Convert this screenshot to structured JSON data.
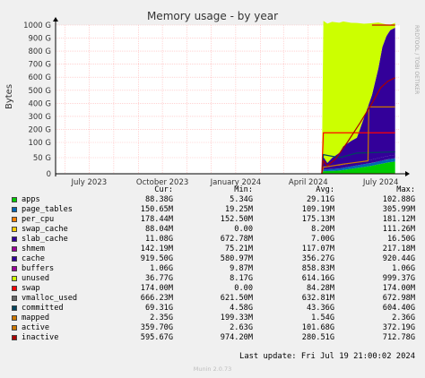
{
  "chart_data": {
    "type": "area",
    "title": "Memory usage - by year",
    "ylabel": "Bytes",
    "side_text": "RRDTOOL / TOBI OETIKER",
    "y_ticks": [
      {
        "value": 0,
        "label": "0"
      },
      {
        "value": 50,
        "label": "50 G"
      },
      {
        "value": 100,
        "label": "100 G"
      },
      {
        "value": 200,
        "label": "200 G"
      },
      {
        "value": 300,
        "label": "300 G"
      },
      {
        "value": 400,
        "label": "400 G"
      },
      {
        "value": 500,
        "label": "500 G"
      },
      {
        "value": 600,
        "label": "600 G"
      },
      {
        "value": 700,
        "label": "700 G"
      },
      {
        "value": 800,
        "label": "800 G"
      },
      {
        "value": 900,
        "label": "900 G"
      },
      {
        "value": 1000,
        "label": "1000 G"
      }
    ],
    "x_ticks": [
      {
        "value": "2023-07",
        "label": "July 2023"
      },
      {
        "value": "2023-10",
        "label": "October 2023"
      },
      {
        "value": "2024-01",
        "label": "January 2024"
      },
      {
        "value": "2024-04",
        "label": "April 2024"
      },
      {
        "value": "2024-07",
        "label": "July 2024"
      }
    ],
    "xlim": [
      "2023-05-20",
      "2024-07-25"
    ],
    "ylim": [
      0,
      1020
    ],
    "y_scale": "segmented linear (0-100 G expanded)",
    "grid": true,
    "stack": [
      {
        "name": "apps",
        "color": "#00cc00",
        "points": [
          [
            "2024-04-18",
            0
          ],
          [
            "2024-04-20",
            8
          ],
          [
            "2024-05-10",
            10
          ],
          [
            "2024-06-01",
            18
          ],
          [
            "2024-06-20",
            25
          ],
          [
            "2024-07-10",
            35
          ],
          [
            "2024-07-19",
            38
          ]
        ]
      },
      {
        "name": "page_tables",
        "color": "#0066b3",
        "points": [
          [
            "2024-04-18",
            0
          ],
          [
            "2024-04-20",
            5
          ],
          [
            "2024-06-01",
            8
          ],
          [
            "2024-07-19",
            10
          ]
        ]
      },
      {
        "name": "swap_cache",
        "color": "#ffcc00",
        "points": [
          [
            "2024-04-18",
            0
          ],
          [
            "2024-07-19",
            0.1
          ]
        ]
      },
      {
        "name": "slab_cache",
        "color": "#330099",
        "points": [
          [
            "2024-04-18",
            0
          ],
          [
            "2024-04-20",
            10
          ],
          [
            "2024-05-15",
            9
          ],
          [
            "2024-06-10",
            10
          ],
          [
            "2024-07-19",
            11
          ]
        ]
      },
      {
        "name": "cache",
        "color": "#330099",
        "points": [
          [
            "2024-04-18",
            0
          ],
          [
            "2024-04-20",
            30
          ],
          [
            "2024-04-25",
            10
          ],
          [
            "2024-05-01",
            25
          ],
          [
            "2024-05-10",
            40
          ],
          [
            "2024-05-15",
            60
          ],
          [
            "2024-05-25",
            80
          ],
          [
            "2024-06-01",
            100
          ],
          [
            "2024-06-10",
            250
          ],
          [
            "2024-06-20",
            420
          ],
          [
            "2024-06-28",
            620
          ],
          [
            "2024-07-03",
            780
          ],
          [
            "2024-07-08",
            860
          ],
          [
            "2024-07-13",
            905
          ],
          [
            "2024-07-19",
            920
          ]
        ]
      },
      {
        "name": "buffers",
        "color": "#990099",
        "points": [
          [
            "2024-04-18",
            0
          ],
          [
            "2024-07-19",
            1
          ]
        ]
      },
      {
        "name": "unused",
        "color": "#ccff00",
        "points": [
          [
            "2024-04-18",
            0
          ],
          [
            "2024-04-20",
            980
          ],
          [
            "2024-05-01",
            975
          ],
          [
            "2024-05-15",
            940
          ],
          [
            "2024-06-01",
            880
          ],
          [
            "2024-06-10",
            720
          ],
          [
            "2024-06-20",
            550
          ],
          [
            "2024-06-28",
            350
          ],
          [
            "2024-07-03",
            180
          ],
          [
            "2024-07-08",
            90
          ],
          [
            "2024-07-13",
            40
          ],
          [
            "2024-07-19",
            37
          ]
        ]
      }
    ],
    "lines": [
      {
        "name": "swap",
        "color": "#ff0000",
        "points": [
          [
            "2024-04-18",
            0
          ],
          [
            "2024-04-20",
            174
          ],
          [
            "2024-07-19",
            174
          ]
        ]
      },
      {
        "name": "committed",
        "color": "#00455f",
        "points": [
          [
            "2024-04-18",
            0
          ],
          [
            "2024-04-20",
            60
          ],
          [
            "2024-05-10",
            50
          ],
          [
            "2024-06-01",
            65
          ],
          [
            "2024-07-19",
            69
          ]
        ]
      },
      {
        "name": "active",
        "color": "#cc7700",
        "points": [
          [
            "2024-04-18",
            0
          ],
          [
            "2024-04-20",
            20
          ],
          [
            "2024-05-15",
            30
          ],
          [
            "2024-06-15",
            40
          ],
          [
            "2024-06-16",
            372
          ],
          [
            "2024-07-19",
            372
          ]
        ]
      },
      {
        "name": "inactive",
        "color": "#aa0000",
        "points": [
          [
            "2024-04-18",
            0
          ],
          [
            "2024-04-20",
            40
          ],
          [
            "2024-04-25",
            25
          ],
          [
            "2024-05-05",
            45
          ],
          [
            "2024-05-20",
            100
          ],
          [
            "2024-06-05",
            250
          ],
          [
            "2024-06-20",
            400
          ],
          [
            "2024-07-01",
            520
          ],
          [
            "2024-07-10",
            570
          ],
          [
            "2024-07-19",
            596
          ]
        ]
      },
      {
        "name": "per_cpu",
        "color": "#ff8000",
        "points": [
          [
            "2024-04-20",
            0.2
          ],
          [
            "2024-07-19",
            0.2
          ]
        ]
      }
    ],
    "right_edge_line": {
      "color": "#cc0000",
      "value": 1000,
      "from": "2024-06-20",
      "to": "2024-07-19"
    }
  },
  "legend": {
    "headers": {
      "cur": "Cur:",
      "min": "Min:",
      "avg": "Avg:",
      "max": "Max:"
    },
    "rows": [
      {
        "name": "apps",
        "color": "#00cc00",
        "cur": "88.38G",
        "min": "5.34G",
        "avg": "29.11G",
        "max": "102.88G"
      },
      {
        "name": "page_tables",
        "color": "#0066b3",
        "cur": "150.65M",
        "min": "19.25M",
        "avg": "109.19M",
        "max": "305.99M"
      },
      {
        "name": "per_cpu",
        "color": "#ff8000",
        "cur": "178.44M",
        "min": "152.50M",
        "avg": "175.13M",
        "max": "181.12M"
      },
      {
        "name": "swap_cache",
        "color": "#ffcc00",
        "cur": "88.04M",
        "min": "0.00",
        "avg": "8.20M",
        "max": "111.26M"
      },
      {
        "name": "slab_cache",
        "color": "#330099",
        "cur": "11.08G",
        "min": "672.78M",
        "avg": "7.00G",
        "max": "16.50G"
      },
      {
        "name": "shmem",
        "color": "#990099",
        "cur": "142.19M",
        "min": "75.21M",
        "avg": "117.07M",
        "max": "217.18M"
      },
      {
        "name": "cache",
        "color": "#330099",
        "cur": "919.50G",
        "min": "580.97M",
        "avg": "356.27G",
        "max": "920.44G"
      },
      {
        "name": "buffers",
        "color": "#990099",
        "cur": "1.06G",
        "min": "9.87M",
        "avg": "858.83M",
        "max": "1.06G"
      },
      {
        "name": "unused",
        "color": "#ccff00",
        "cur": "36.77G",
        "min": "8.17G",
        "avg": "614.16G",
        "max": "999.37G"
      },
      {
        "name": "swap",
        "color": "#ff0000",
        "cur": "174.00M",
        "min": "0.00",
        "avg": "84.28M",
        "max": "174.00M"
      },
      {
        "name": "vmalloc_used",
        "color": "#666666",
        "cur": "666.23M",
        "min": "621.50M",
        "avg": "632.81M",
        "max": "672.98M"
      },
      {
        "name": "committed",
        "color": "#00455f",
        "cur": "69.31G",
        "min": "4.58G",
        "avg": "43.36G",
        "max": "604.40G"
      },
      {
        "name": "mapped",
        "color": "#cc7700",
        "cur": "2.35G",
        "min": "199.33M",
        "avg": "1.54G",
        "max": "2.36G"
      },
      {
        "name": "active",
        "color": "#cc7700",
        "cur": "359.70G",
        "min": "2.63G",
        "avg": "101.68G",
        "max": "372.19G"
      },
      {
        "name": "inactive",
        "color": "#aa0000",
        "cur": "595.67G",
        "min": "974.20M",
        "avg": "280.51G",
        "max": "712.78G"
      }
    ]
  },
  "footer": {
    "last_update": "Last update:  Fri Jul 19 21:00:02 2024",
    "version": "Munin 2.0.73"
  }
}
